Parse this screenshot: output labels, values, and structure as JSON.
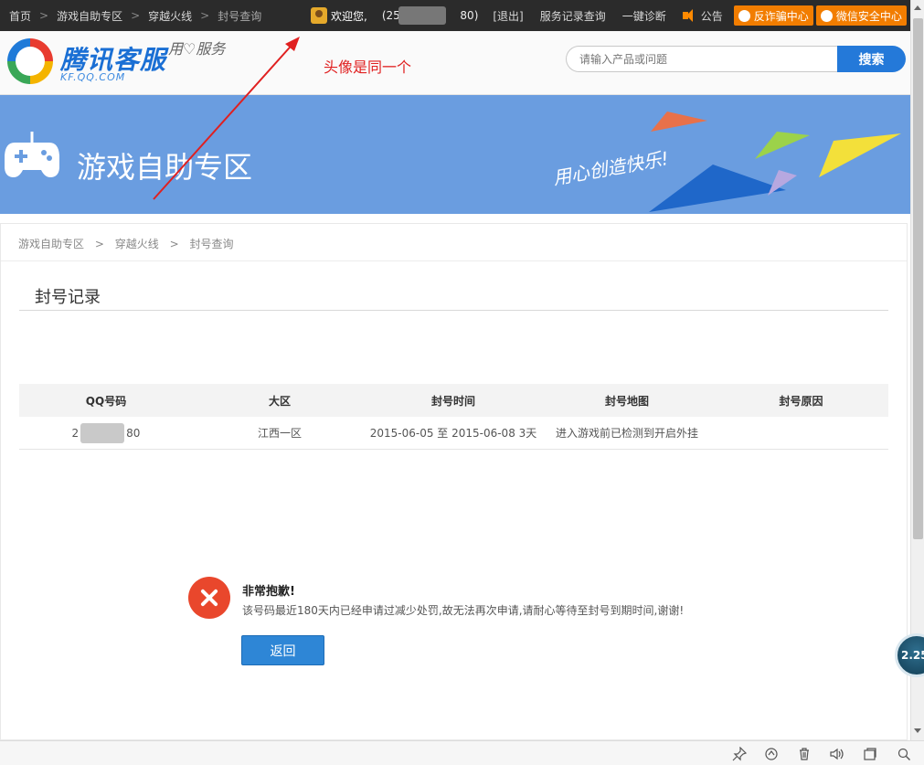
{
  "topbar": {
    "breadcrumb": [
      "首页",
      "游戏自助专区",
      "穿越火线",
      "封号查询"
    ],
    "separator": ">",
    "welcome": "欢迎您,",
    "qq_prefix": "(257",
    "qq_suffix": "80)",
    "logout": "[退出]",
    "service_records": "服务记录查询",
    "diagnose": "一键诊断",
    "notice": "公告",
    "anti_fraud": "反诈骗中心",
    "wechat_security": "微信安全中心"
  },
  "header": {
    "logo_title": "腾讯客服",
    "logo_sub": "KF.QQ.COM",
    "slogan": "用♡服务",
    "annotation": "头像是同一个",
    "search_placeholder": "请输入产品或问题",
    "search_button": "搜索"
  },
  "banner": {
    "title": "游戏自助专区",
    "slogan": "用心创造快乐!"
  },
  "page": {
    "breadcrumb": [
      "游戏自助专区",
      "穿越火线",
      "封号查询"
    ],
    "separator": ">",
    "section_title": "封号记录"
  },
  "table": {
    "headers": [
      "QQ号码",
      "大区",
      "封号时间",
      "封号地图",
      "封号原因"
    ],
    "rows": [
      {
        "qq_prefix": "2",
        "qq_suffix": "80",
        "region": "江西一区",
        "time": "2015-06-05 至 2015-06-08 3天",
        "map": "进入游戏前已检测到开启外挂",
        "reason": ""
      }
    ]
  },
  "error": {
    "title": "非常抱歉!",
    "message": "该号码最近180天内已经申请过减少处罚,故无法再次申请,请耐心等待至封号到期时间,谢谢!",
    "back_button": "返回"
  },
  "float_widget": {
    "value": "2.25"
  },
  "colors": {
    "topbar_bg": "#2b2b2b",
    "banner_bg": "#6a9de0",
    "accent_blue": "#2479d9",
    "orange": "#f27d00",
    "error_red": "#e9472c",
    "annotation_red": "#e02020"
  }
}
